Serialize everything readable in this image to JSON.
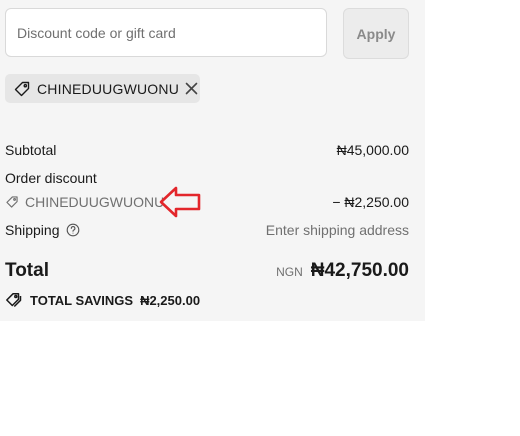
{
  "discount": {
    "placeholder": "Discount code or gift card",
    "apply_label": "Apply",
    "applied_code": "CHINEDUUGWUONU"
  },
  "summary": {
    "subtotal_label": "Subtotal",
    "subtotal_value": "₦45,000.00",
    "order_discount_label": "Order discount",
    "discount_code": "CHINEDUUGWUONU",
    "discount_value": "− ₦2,250.00",
    "shipping_label": "Shipping",
    "shipping_value": "Enter shipping address",
    "total_label": "Total",
    "currency": "NGN",
    "total_value": "₦42,750.00",
    "savings_label": "TOTAL SAVINGS",
    "savings_value": "₦2,250.00"
  },
  "colors": {
    "panel_bg": "#f5f5f5",
    "annotation_arrow": "#e3262b"
  }
}
